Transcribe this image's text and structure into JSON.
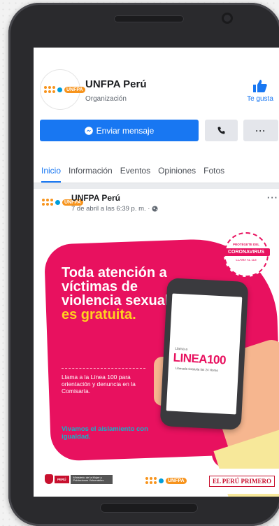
{
  "page": {
    "name": "UNFPA Perú",
    "category": "Organización",
    "logo_text": "UNFPA",
    "like_label": "Te gusta"
  },
  "actions": {
    "message_label": "Enviar mensaje",
    "more_label": "···"
  },
  "tabs": [
    {
      "label": "Inicio",
      "active": true
    },
    {
      "label": "Información",
      "active": false
    },
    {
      "label": "Eventos",
      "active": false
    },
    {
      "label": "Opiniones",
      "active": false
    },
    {
      "label": "Fotos",
      "active": false
    }
  ],
  "post": {
    "author": "UNFPA Perú",
    "date": "7 de abril a las 6:39 p. m. ·",
    "more_label": "···",
    "image": {
      "headline_part1": "Toda atención a víctimas de violencia sexual",
      "headline_highlight": "es gratuita.",
      "subtext": "Llama a la Línea 100 para orientación y denuncia en la Comisaría.",
      "tagline": "Vivamos el aislamiento con igualdad.",
      "badge_top": "PROTÉGETE DEL",
      "badge_main": "CORONAVIRUS",
      "badge_sub": "LLAMA AL 113",
      "phone_llama": "Llama a",
      "phone_linea": "LINEA100",
      "phone_sub": "Llamada Gratuita las 24 Horas",
      "footer_peru": "PERÚ",
      "footer_ministry": "Ministerio de la Mujer y Poblaciones Vulnerables",
      "footer_unfpa": "UNFPA",
      "footer_primero": "EL PERÚ PRIMERO"
    }
  },
  "colors": {
    "facebook_blue": "#1877f2",
    "unfpa_orange": "#f7941d",
    "campaign_pink": "#e8115f",
    "highlight_yellow": "#ffd21f",
    "tagline_teal": "#10b6c9"
  }
}
